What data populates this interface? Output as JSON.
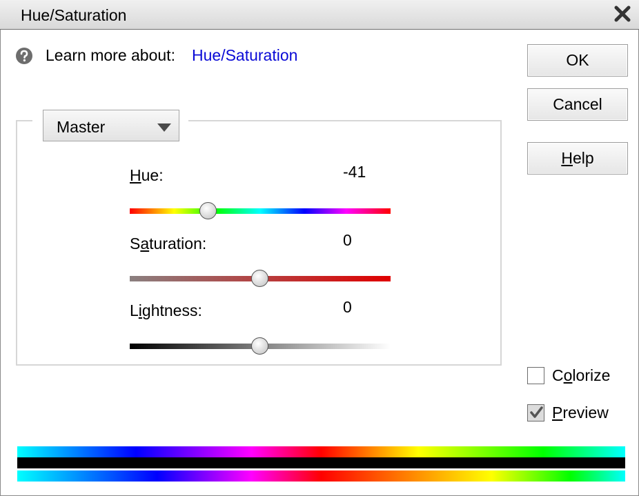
{
  "window": {
    "title": "Hue/Saturation"
  },
  "help": {
    "icon": "question-circle-icon",
    "learn_more_label": "Learn more about:",
    "learn_more_link": "Hue/Saturation",
    "link_color": "#0a0ad6"
  },
  "buttons": {
    "ok": "OK",
    "cancel": "Cancel",
    "help_prefix": "H",
    "help_rest": "elp"
  },
  "channel": {
    "selected": "Master"
  },
  "sliders": {
    "hue": {
      "label_u": "H",
      "label_rest": "ue:",
      "value": "-41",
      "min": -180,
      "max": 180
    },
    "saturation": {
      "label_a": "S",
      "label_u": "a",
      "label_rest": "turation:",
      "value": "0",
      "min": -100,
      "max": 100
    },
    "lightness": {
      "label_a": "L",
      "label_u": "i",
      "label_rest": "ghtness:",
      "value": "0",
      "min": -100,
      "max": 100
    }
  },
  "options": {
    "colorize": {
      "label_a": "C",
      "label_u": "o",
      "label_rest": "lorize",
      "checked": false
    },
    "preview": {
      "label_u": "P",
      "label_rest": "review",
      "checked": true
    }
  }
}
